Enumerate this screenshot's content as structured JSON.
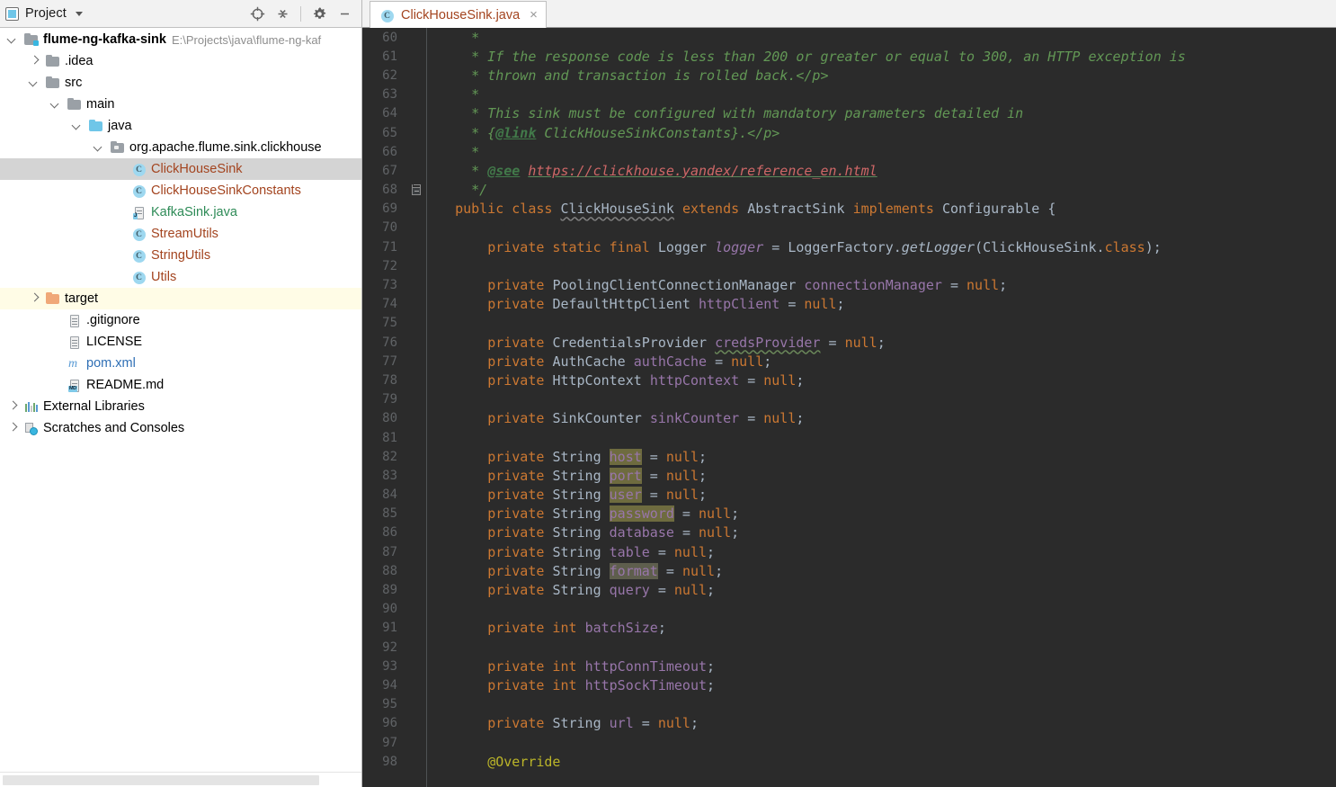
{
  "project_panel": {
    "title": "Project",
    "icons": [
      "project-icon",
      "chevron-down-icon",
      "locate-icon",
      "collapse-all-icon",
      "gear-icon",
      "minimize-icon"
    ],
    "tree": [
      {
        "depth": 0,
        "arrow": "open",
        "icon": "folder-module",
        "label": "flume-ng-kafka-sink",
        "bold": true,
        "sub": "E:\\Projects\\java\\flume-ng-kaf",
        "state": "none"
      },
      {
        "depth": 1,
        "arrow": "closed",
        "icon": "folder-gray",
        "label": ".idea",
        "bold": false,
        "sub": "",
        "state": "none"
      },
      {
        "depth": 1,
        "arrow": "open",
        "icon": "folder-gray",
        "label": "src",
        "bold": false,
        "sub": "",
        "state": "none"
      },
      {
        "depth": 2,
        "arrow": "open",
        "icon": "folder-gray",
        "label": "main",
        "bold": false,
        "sub": "",
        "state": "none"
      },
      {
        "depth": 3,
        "arrow": "open",
        "icon": "folder-source",
        "label": "java",
        "bold": false,
        "sub": "",
        "state": "none"
      },
      {
        "depth": 4,
        "arrow": "open",
        "icon": "folder-package",
        "label": "org.apache.flume.sink.clickhouse",
        "bold": false,
        "sub": "",
        "state": "none"
      },
      {
        "depth": 5,
        "arrow": "none",
        "icon": "class-icon",
        "label": "ClickHouseSink",
        "bold": false,
        "sub": "",
        "state": "selected"
      },
      {
        "depth": 5,
        "arrow": "none",
        "icon": "class-icon",
        "label": "ClickHouseSinkConstants",
        "bold": false,
        "sub": "",
        "state": "none"
      },
      {
        "depth": 5,
        "arrow": "none",
        "icon": "java-file-icon",
        "label": "KafkaSink.java",
        "bold": false,
        "sub": "",
        "state": "none"
      },
      {
        "depth": 5,
        "arrow": "none",
        "icon": "class-icon",
        "label": "StreamUtils",
        "bold": false,
        "sub": "",
        "state": "none"
      },
      {
        "depth": 5,
        "arrow": "none",
        "icon": "class-icon",
        "label": "StringUtils",
        "bold": false,
        "sub": "",
        "state": "none"
      },
      {
        "depth": 5,
        "arrow": "none",
        "icon": "class-icon",
        "label": "Utils",
        "bold": false,
        "sub": "",
        "state": "none"
      },
      {
        "depth": 1,
        "arrow": "closed",
        "icon": "folder-excluded",
        "label": "target",
        "bold": false,
        "sub": "",
        "state": "excluded"
      },
      {
        "depth": 2,
        "arrow": "none",
        "icon": "text-file-icon",
        "label": ".gitignore",
        "bold": false,
        "sub": "",
        "state": "none"
      },
      {
        "depth": 2,
        "arrow": "none",
        "icon": "text-file-icon",
        "label": "LICENSE",
        "bold": false,
        "sub": "",
        "state": "none"
      },
      {
        "depth": 2,
        "arrow": "none",
        "icon": "maven-icon",
        "label": "pom.xml",
        "bold": false,
        "sub": "",
        "state": "none"
      },
      {
        "depth": 2,
        "arrow": "none",
        "icon": "markdown-icon",
        "label": "README.md",
        "bold": false,
        "sub": "",
        "state": "none"
      },
      {
        "depth": 0,
        "arrow": "closed",
        "icon": "libraries-icon",
        "label": "External Libraries",
        "bold": false,
        "sub": "",
        "state": "none"
      },
      {
        "depth": 0,
        "arrow": "closed",
        "icon": "scratches-icon",
        "label": "Scratches and Consoles",
        "bold": false,
        "sub": "",
        "state": "none"
      }
    ]
  },
  "editor": {
    "tab": {
      "label": "ClickHouseSink.java",
      "icon": "class-icon",
      "close": "×"
    },
    "first_line_number": 60,
    "lines": [
      {
        "n": 60,
        "fold": false,
        "html": "    <span class=\"cmt\">*</span>"
      },
      {
        "n": 61,
        "fold": false,
        "html": "    <span class=\"cmt\">* If the response code is less than 200 or greater or equal to 300, an HTTP exception is</span>"
      },
      {
        "n": 62,
        "fold": false,
        "html": "    <span class=\"cmt\">* thrown and transaction is rolled back.&lt;/p&gt;</span>"
      },
      {
        "n": 63,
        "fold": false,
        "html": "    <span class=\"cmt\">*</span>"
      },
      {
        "n": 64,
        "fold": false,
        "html": "    <span class=\"cmt\">* This sink must be configured with mandatory parameters detailed in</span>"
      },
      {
        "n": 65,
        "fold": false,
        "html": "    <span class=\"cmt\">* {</span><span class=\"cmt-tag\">@link</span><span class=\"cmt\"> ClickHouseSinkConstants}.&lt;/p&gt;</span>"
      },
      {
        "n": 66,
        "fold": false,
        "html": "    <span class=\"cmt\">*</span>"
      },
      {
        "n": 67,
        "fold": false,
        "html": "    <span class=\"cmt\">* </span><span class=\"cmt-tag\">@see</span><span class=\"cmt\"> </span><span class=\"url\">https://clickhouse.yandex/reference_en.html</span>"
      },
      {
        "n": 68,
        "fold": true,
        "html": "   <span class=\"cmt\"> */</span>"
      },
      {
        "n": 69,
        "fold": false,
        "html": "  <span class=\"kw\">public class </span><span class=\"typ wavy-gray\">ClickHouseSink</span><span class=\"typ\"> </span><span class=\"kw\">extends </span><span class=\"typ\">AbstractSink </span><span class=\"kw\">implements </span><span class=\"typ\">Configurable {</span>"
      },
      {
        "n": 70,
        "fold": false,
        "html": ""
      },
      {
        "n": 71,
        "fold": false,
        "html": "      <span class=\"kw\">private static final </span><span class=\"typ\">Logger </span><span class=\"fld-i\">logger </span><span class=\"typ\">= LoggerFactory.</span><span class=\"meth-i\">getLogger</span><span class=\"typ\">(ClickHouseSink.</span><span class=\"kw\">class</span><span class=\"typ\">);</span>"
      },
      {
        "n": 72,
        "fold": false,
        "html": ""
      },
      {
        "n": 73,
        "fold": false,
        "html": "      <span class=\"kw\">private </span><span class=\"typ\">PoolingClientConnectionManager </span><span class=\"fld\">connectionManager </span><span class=\"typ\">= </span><span class=\"kw\">null</span><span class=\"typ\">;</span>"
      },
      {
        "n": 74,
        "fold": false,
        "html": "      <span class=\"kw\">private </span><span class=\"typ\">DefaultHttpClient </span><span class=\"fld\">httpClient </span><span class=\"typ\">= </span><span class=\"kw\">null</span><span class=\"typ\">;</span>"
      },
      {
        "n": 75,
        "fold": false,
        "html": ""
      },
      {
        "n": 76,
        "fold": false,
        "html": "      <span class=\"kw\">private </span><span class=\"typ\">CredentialsProvider </span><span class=\"fld wavy\">credsProvider</span><span class=\"typ\"> = </span><span class=\"kw\">null</span><span class=\"typ\">;</span>"
      },
      {
        "n": 77,
        "fold": false,
        "html": "      <span class=\"kw\">private </span><span class=\"typ\">AuthCache </span><span class=\"fld\">authCache </span><span class=\"typ\">= </span><span class=\"kw\">null</span><span class=\"typ\">;</span>"
      },
      {
        "n": 78,
        "fold": false,
        "html": "      <span class=\"kw\">private </span><span class=\"typ\">HttpContext </span><span class=\"fld\">httpContext </span><span class=\"typ\">= </span><span class=\"kw\">null</span><span class=\"typ\">;</span>"
      },
      {
        "n": 79,
        "fold": false,
        "html": ""
      },
      {
        "n": 80,
        "fold": false,
        "html": "      <span class=\"kw\">private </span><span class=\"typ\">SinkCounter </span><span class=\"fld\">sinkCounter </span><span class=\"typ\">= </span><span class=\"kw\">null</span><span class=\"typ\">;</span>"
      },
      {
        "n": 81,
        "fold": false,
        "html": ""
      },
      {
        "n": 82,
        "fold": false,
        "html": "      <span class=\"kw\">private </span><span class=\"typ\">String </span><span class=\"fld hl-search\">host</span><span class=\"typ\"> = </span><span class=\"kw\">null</span><span class=\"typ\">;</span>"
      },
      {
        "n": 83,
        "fold": false,
        "html": "      <span class=\"kw\">private </span><span class=\"typ\">String </span><span class=\"fld hl-search\">port</span><span class=\"typ\"> = </span><span class=\"kw\">null</span><span class=\"typ\">;</span>"
      },
      {
        "n": 84,
        "fold": false,
        "html": "      <span class=\"kw\">private </span><span class=\"typ\">String </span><span class=\"fld hl-search\">user</span><span class=\"typ\"> = </span><span class=\"kw\">null</span><span class=\"typ\">;</span>"
      },
      {
        "n": 85,
        "fold": false,
        "html": "      <span class=\"kw\">private </span><span class=\"typ\">String </span><span class=\"fld hl-search\">password</span><span class=\"typ\"> = </span><span class=\"kw\">null</span><span class=\"typ\">;</span>"
      },
      {
        "n": 86,
        "fold": false,
        "html": "      <span class=\"kw\">private </span><span class=\"typ\">String </span><span class=\"fld\">database </span><span class=\"typ\">= </span><span class=\"kw\">null</span><span class=\"typ\">;</span>"
      },
      {
        "n": 87,
        "fold": false,
        "html": "      <span class=\"kw\">private </span><span class=\"typ\">String </span><span class=\"fld\">table </span><span class=\"typ\">= </span><span class=\"kw\">null</span><span class=\"typ\">;</span>"
      },
      {
        "n": 88,
        "fold": false,
        "html": "      <span class=\"kw\">private </span><span class=\"typ\">String </span><span class=\"fld hl-ident\">format</span><span class=\"typ\"> = </span><span class=\"kw\">null</span><span class=\"typ\">;</span>"
      },
      {
        "n": 89,
        "fold": false,
        "html": "      <span class=\"kw\">private </span><span class=\"typ\">String </span><span class=\"fld\">query </span><span class=\"typ\">= </span><span class=\"kw\">null</span><span class=\"typ\">;</span>"
      },
      {
        "n": 90,
        "fold": false,
        "html": ""
      },
      {
        "n": 91,
        "fold": false,
        "html": "      <span class=\"kw\">private int </span><span class=\"fld\">batchSize</span><span class=\"typ\">;</span>"
      },
      {
        "n": 92,
        "fold": false,
        "html": ""
      },
      {
        "n": 93,
        "fold": false,
        "html": "      <span class=\"kw\">private int </span><span class=\"fld\">httpConnTimeout</span><span class=\"typ\">;</span>"
      },
      {
        "n": 94,
        "fold": false,
        "html": "      <span class=\"kw\">private int </span><span class=\"fld\">httpSockTimeout</span><span class=\"typ\">;</span>"
      },
      {
        "n": 95,
        "fold": false,
        "html": ""
      },
      {
        "n": 96,
        "fold": false,
        "html": "      <span class=\"kw\">private </span><span class=\"typ\">String </span><span class=\"fld\">url </span><span class=\"typ\">= </span><span class=\"kw\">null</span><span class=\"typ\">;</span>"
      },
      {
        "n": 97,
        "fold": false,
        "html": ""
      },
      {
        "n": 98,
        "fold": false,
        "html": "      <span class=\"anno\">@Override</span>"
      }
    ]
  },
  "colors": {
    "editor_bg": "#2B2B2B",
    "gutter_bg": "#313335",
    "keyword": "#CC7832",
    "field": "#9876AA",
    "text": "#A9B7C6",
    "comment": "#629755",
    "annotation": "#BBB529",
    "string_url": "#CE6767",
    "line_number": "#606366",
    "tree_selection": "#D4D4D4",
    "excluded_row": "#FFFCE6",
    "class_name": "#A3441F"
  }
}
